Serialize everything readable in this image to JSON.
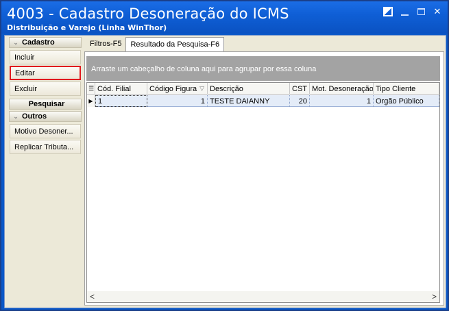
{
  "window": {
    "title": "4003 - Cadastro Desoneração do ICMS",
    "subtitle": "Distribuição e Varejo (Linha WinThor)"
  },
  "sidebar": {
    "groups": [
      {
        "label": "Cadastro",
        "items": [
          {
            "label": "Incluir"
          },
          {
            "label": "Editar",
            "highlighted": true
          },
          {
            "label": "Excluir"
          }
        ]
      },
      {
        "label": "Pesquisar",
        "items": []
      },
      {
        "label": "Outros",
        "items": [
          {
            "label": "Motivo Desoner..."
          },
          {
            "label": "Replicar Tributa..."
          }
        ]
      }
    ]
  },
  "tabs": [
    {
      "label": "Filtros-F5",
      "active": false
    },
    {
      "label": "Resultado da Pesquisa-F6",
      "active": true
    }
  ],
  "group_area_hint": "Arraste um cabeçalho de coluna aqui para agrupar por essa coluna",
  "grid": {
    "columns": [
      "Cód. Filial",
      "Código Figura",
      "Descrição",
      "CST",
      "Mot. Desoneração",
      "Tipo Cliente"
    ],
    "sorted_column": "Código Figura",
    "rows": [
      {
        "filial": "1",
        "figura": "1",
        "descricao": "TESTE DAIANNY",
        "cst": "20",
        "mot_desoneracao": "1",
        "tipo_cliente": "Orgão Público"
      }
    ]
  },
  "colors": {
    "title_bar": "#0f5fd6",
    "highlight_border": "#e0191e",
    "selected_row": "#e4ecf8",
    "group_area": "#a3a3a3"
  }
}
